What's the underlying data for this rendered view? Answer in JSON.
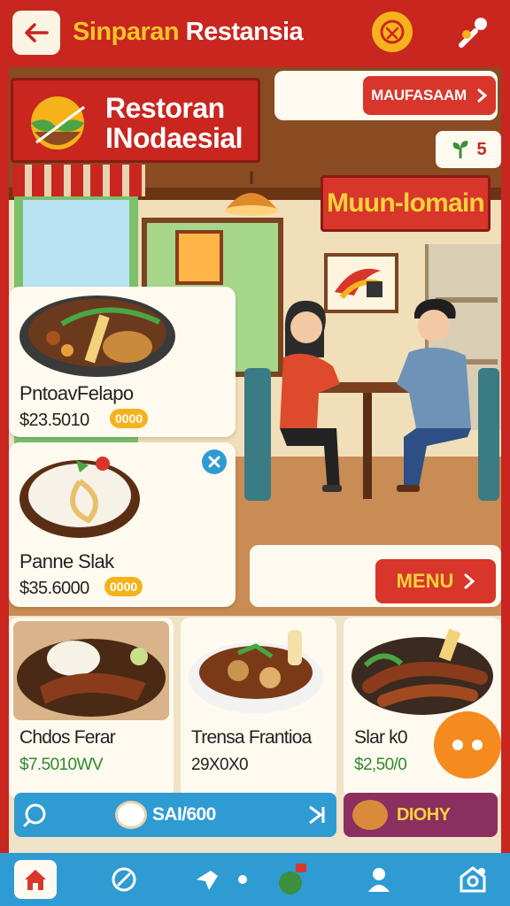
{
  "app_bar": {
    "title_part1": "Sinparan",
    "title_part2": "Restansia"
  },
  "restaurant": {
    "logo_line1": "Restoran",
    "logo_line2": "INodaesial",
    "top_button_label": "MAUFASAAM",
    "mini_badge_value": "5",
    "sign_text": "Muun-lomain"
  },
  "featured_dishes": [
    {
      "name": "PntoavFelapo",
      "price": "$23.5010",
      "tag": "0000"
    },
    {
      "name": "Panne Slak",
      "price": "$35.6000",
      "tag": "0000"
    }
  ],
  "menu_button_label": "MENU",
  "bottom_dishes": [
    {
      "name": "Chdos Ferar",
      "price": "$7.5010WV"
    },
    {
      "name": "Trensa Frantioa",
      "price": "29X0X0"
    },
    {
      "name": "Slar k0",
      "price": "$2,50/0"
    }
  ],
  "action_bar": {
    "search_label": "SAI/600",
    "extra_label": "DIOHY"
  },
  "colors": {
    "primary_red": "#c8261f",
    "accent_yellow": "#f6b21b",
    "nav_blue": "#2f9bd3",
    "fab_orange": "#f58a1f",
    "price_green": "#2f8a2f"
  },
  "icons": {
    "back": "back-arrow-icon",
    "badge": "star-badge-icon",
    "top_right": "user-share-icon",
    "nav": [
      "home-icon",
      "compass-icon",
      "bird-icon",
      "dot-icon",
      "chat-icon",
      "profile-icon",
      "location-icon"
    ]
  }
}
